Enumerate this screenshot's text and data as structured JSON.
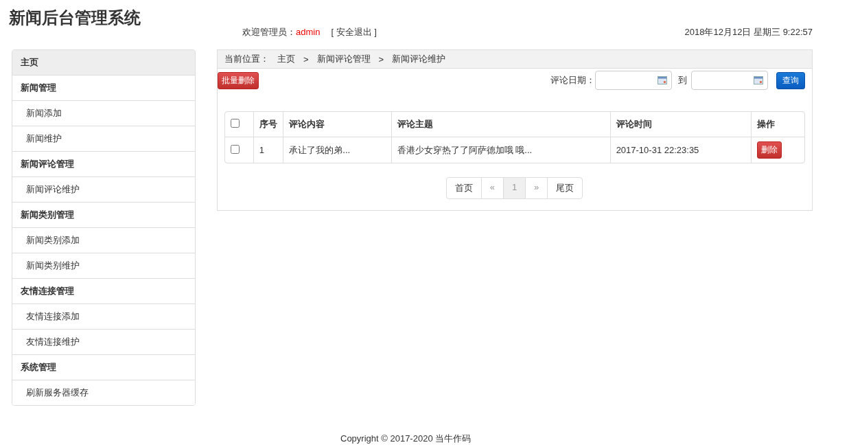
{
  "app_title": "新闻后台管理系统",
  "header": {
    "welcome_label": "欢迎管理员：",
    "username": "admin",
    "logout": "[ 安全退出 ]",
    "datetime": "2018年12月12日 星期三 9:22:57"
  },
  "sidebar": {
    "items": [
      {
        "label": "主页",
        "kind": "header",
        "selected": true
      },
      {
        "label": "新闻管理",
        "kind": "header",
        "selected": false
      },
      {
        "label": "新闻添加",
        "kind": "link",
        "selected": false
      },
      {
        "label": "新闻维护",
        "kind": "link",
        "selected": false
      },
      {
        "label": "新闻评论管理",
        "kind": "header",
        "selected": false
      },
      {
        "label": "新闻评论维护",
        "kind": "link",
        "selected": false
      },
      {
        "label": "新闻类别管理",
        "kind": "header",
        "selected": false
      },
      {
        "label": "新闻类别添加",
        "kind": "link",
        "selected": false
      },
      {
        "label": "新闻类别维护",
        "kind": "link",
        "selected": false
      },
      {
        "label": "友情连接管理",
        "kind": "header",
        "selected": false
      },
      {
        "label": "友情连接添加",
        "kind": "link",
        "selected": false
      },
      {
        "label": "友情连接维护",
        "kind": "link",
        "selected": false
      },
      {
        "label": "系统管理",
        "kind": "header",
        "selected": false
      },
      {
        "label": "刷新服务器缓存",
        "kind": "link",
        "selected": false
      }
    ]
  },
  "breadcrumb": {
    "label": "当前位置：",
    "items": [
      "主页",
      "新闻评论管理",
      "新闻评论维护"
    ],
    "separator": ">"
  },
  "toolbar": {
    "batch_delete": "批量删除",
    "date_label": "评论日期：",
    "to_label": "到",
    "search": "查询"
  },
  "table": {
    "columns": [
      "序号",
      "评论内容",
      "评论主题",
      "评论时间",
      "操作"
    ],
    "header_checked": false,
    "rows": [
      {
        "checked": false,
        "cells": [
          "1",
          "承让了我的弟...",
          "香港少女穿热了了阿萨德加哦 哦...",
          "2017-10-31 22:23:35"
        ],
        "action": "删除"
      }
    ]
  },
  "pagination": [
    {
      "label": "首页",
      "disabled": false,
      "selected": false
    },
    {
      "label": "«",
      "disabled": true,
      "selected": false
    },
    {
      "label": "1",
      "disabled": false,
      "selected": true
    },
    {
      "label": "»",
      "disabled": true,
      "selected": false
    },
    {
      "label": "尾页",
      "disabled": false,
      "selected": false
    }
  ],
  "footer": "Copyright © 2017-2020 当牛作码"
}
